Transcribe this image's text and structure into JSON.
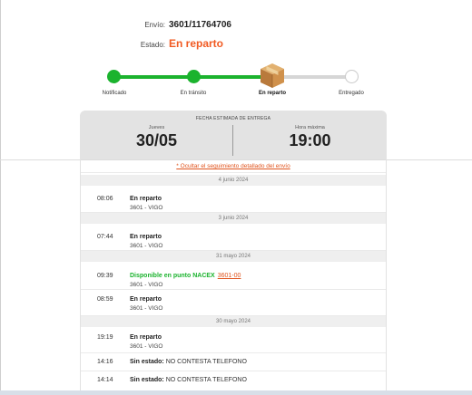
{
  "header": {
    "envio_label": "Envío:",
    "envio_value": "3601/11764706",
    "estado_label": "Estado:",
    "estado_value": "En reparto"
  },
  "tracker": {
    "steps": [
      {
        "label": "Notificado",
        "state": "done"
      },
      {
        "label": "En tránsito",
        "state": "done"
      },
      {
        "label": "En reparto",
        "state": "current",
        "icon": "package-box-icon"
      },
      {
        "label": "Entregado",
        "state": "pending"
      }
    ],
    "colors": {
      "done": "#1bb32e",
      "pending": "#d6d6d6"
    }
  },
  "delivery": {
    "caption": "FECHA ESTIMADA DE ENTREGA",
    "day_label": "Jueves",
    "date": "30/05",
    "time_label": "Hora máxima",
    "time": "19:00"
  },
  "history": {
    "toggle_text": "* Ocultar el seguimiento detallado del envío",
    "groups": [
      {
        "date": "4 junio 2024",
        "events": [
          {
            "time": "08:06",
            "status": "En reparto",
            "location": "3601 - VIGO"
          }
        ]
      },
      {
        "date": "3 junio 2024",
        "events": [
          {
            "time": "07:44",
            "status": "En reparto",
            "location": "3601 - VIGO"
          }
        ]
      },
      {
        "date": "31 mayo 2024",
        "events": [
          {
            "time": "09:39",
            "status": "Disponible en punto NACEX",
            "ref": "3601-00",
            "location": "3601 - VIGO"
          },
          {
            "time": "08:59",
            "status": "En reparto",
            "location": "3601 - VIGO"
          }
        ]
      },
      {
        "date": "30 mayo 2024",
        "events": [
          {
            "time": "19:19",
            "status": "En reparto",
            "location": "3601 - VIGO"
          },
          {
            "time": "14:16",
            "status": "Sin estado:",
            "detail": "NO CONTESTA TELEFONO"
          },
          {
            "time": "14:14",
            "status": "Sin estado:",
            "detail": "NO CONTESTA TELEFONO"
          }
        ]
      }
    ]
  },
  "colors": {
    "accent": "#f15a22",
    "success": "#1bb32e"
  }
}
